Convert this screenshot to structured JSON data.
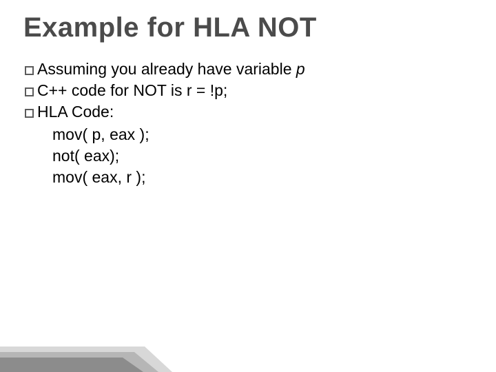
{
  "title": "Example for HLA NOT",
  "bullets": [
    {
      "prefix": "Assuming you already have variable ",
      "italic": "p"
    },
    {
      "text": "C++ code for NOT is r = !p;"
    },
    {
      "text": "HLA Code:"
    }
  ],
  "code": [
    "mov( p, eax );",
    "not( eax);",
    "mov( eax, r );"
  ]
}
